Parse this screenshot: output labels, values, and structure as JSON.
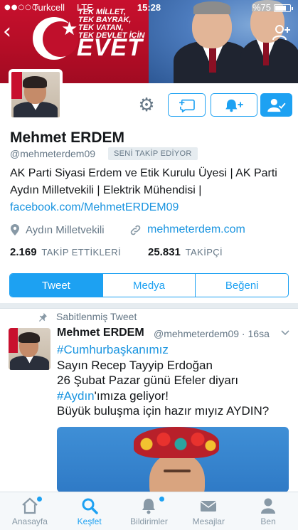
{
  "status_bar": {
    "signal": "●●○○○",
    "carrier": "Turkcell",
    "network": "LTE",
    "time": "15:28",
    "battery_percent": "%75",
    "battery_level": 0.75
  },
  "banner": {
    "slogan_lines": [
      "TEK MİLLET,",
      "TEK BAYRAK,",
      "TEK VATAN,",
      "TEK DEVLET İÇİN"
    ],
    "headline": "EVET"
  },
  "profile": {
    "name": "Mehmet ERDEM",
    "handle": "@mehmeterdem09",
    "follows_you": "SENİ TAKİP EDİYOR",
    "bio_text": "AK Parti Siyasi Erdem ve Etik Kurulu Üyesi | AK Parti Aydın Milletvekili | Elektrik Mühendisi |",
    "bio_link": "facebook.com/MehmetERDEM09",
    "location": "Aydın Milletvekili",
    "website": "mehmeterdem.com",
    "following_count": "2.169",
    "following_label": "TAKİP ETTİKLERİ",
    "followers_count": "25.831",
    "followers_label": "TAKİPÇİ"
  },
  "tabs": [
    {
      "label": "Tweet",
      "active": true
    },
    {
      "label": "Medya",
      "active": false
    },
    {
      "label": "Beğeni",
      "active": false
    }
  ],
  "tweet": {
    "pinned_label": "Sabitlenmiş Tweet",
    "author_name": "Mehmet ERDEM",
    "author_handle": "@mehmeterdem09",
    "time": "16sa",
    "hashtag1": "#Cumhurbaşkanımız",
    "line2": "Sayın Recep Tayyip Erdoğan",
    "line3": "26 Şubat Pazar günü Efeler diyarı",
    "hashtag2": "#Aydın",
    "line4_rest": "'ımıza geliyor!",
    "line5": "Büyük buluşma için hazır mıyız AYDIN?"
  },
  "bottom_nav": [
    {
      "label": "Anasayfa",
      "icon": "home-icon",
      "active": false,
      "dot": true
    },
    {
      "label": "Keşfet",
      "icon": "search-icon",
      "active": true,
      "dot": false
    },
    {
      "label": "Bildirimler",
      "icon": "bell-icon",
      "active": false,
      "dot": true
    },
    {
      "label": "Mesajlar",
      "icon": "mail-icon",
      "active": false,
      "dot": false
    },
    {
      "label": "Ben",
      "icon": "person-icon",
      "active": false,
      "dot": false
    }
  ],
  "colors": {
    "accent": "#1da1f2",
    "link": "#1b95e0",
    "banner_red": "#c8102e",
    "muted": "#657786"
  }
}
